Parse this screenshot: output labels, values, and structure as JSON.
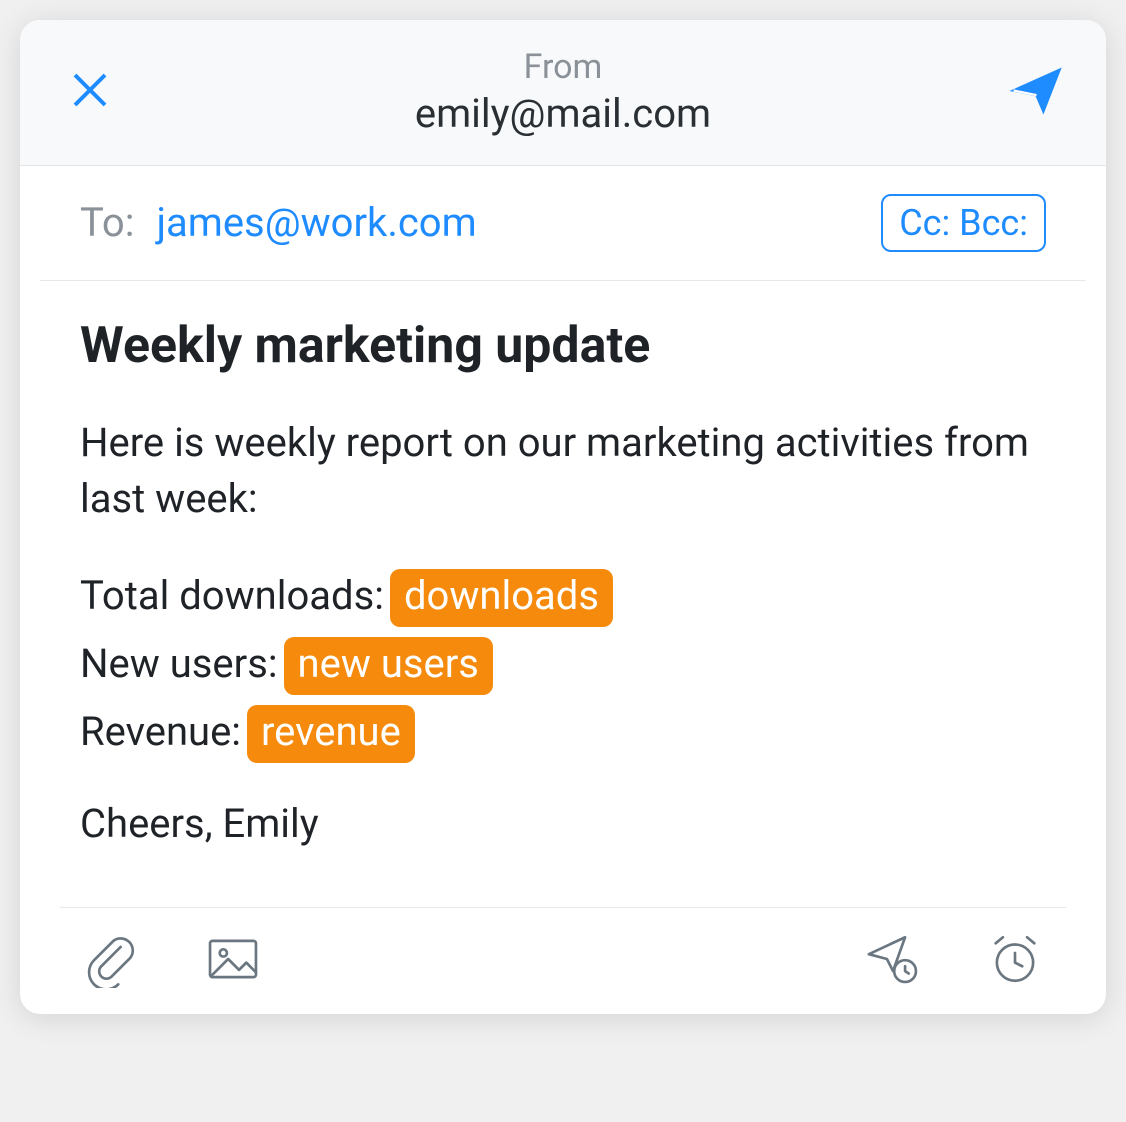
{
  "header": {
    "from_label": "From",
    "from_email": "emily@mail.com"
  },
  "recipients": {
    "to_label": "To:",
    "to_email": "james@work.com",
    "ccbcc_label": "Cc: Bcc:"
  },
  "subject": "Weekly marketing update",
  "intro": "Here is weekly report on our marketing activities from last week:",
  "stats": {
    "downloads_label": "Total downloads:",
    "downloads_tag": "downloads",
    "newusers_label": "New users:",
    "newusers_tag": "new users",
    "revenue_label": "Revenue:",
    "revenue_tag": "revenue"
  },
  "signoff": "Cheers, Emily",
  "colors": {
    "accent": "#1e8cff",
    "tag_bg": "#f58a0c"
  }
}
